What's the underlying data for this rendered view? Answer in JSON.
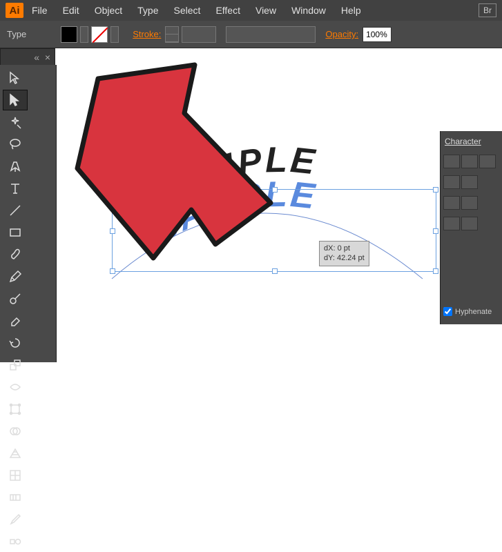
{
  "app": {
    "logo_text": "Ai",
    "br_badge": "Br"
  },
  "menubar": [
    "File",
    "Edit",
    "Object",
    "Type",
    "Select",
    "Effect",
    "View",
    "Window",
    "Help"
  ],
  "toolbar": {
    "type_label": "Type",
    "stroke_label": "Stroke:",
    "opacity_label": "Opacity:",
    "opacity_value": "100%"
  },
  "doctab": {
    "close": "×",
    "collapse": "«"
  },
  "canvas": {
    "text_top": "SAMPLE",
    "text_bottom": "SAMPLE",
    "tooltip_line1": "dX: 0 pt",
    "tooltip_line2": "dY: 42.24 pt"
  },
  "rightpanel": {
    "title": "Character",
    "hyphenate_label": "Hyphenate"
  }
}
